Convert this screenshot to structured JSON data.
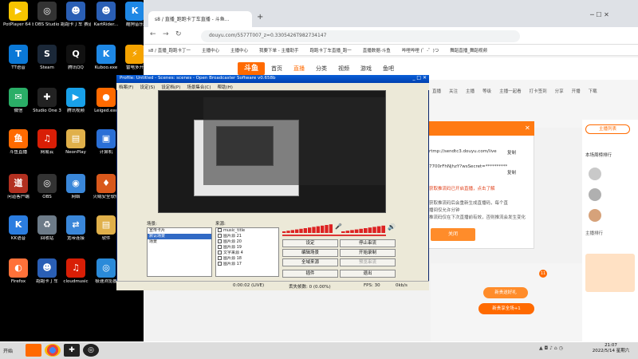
{
  "desktop": {
    "icons": [
      {
        "label": "PotPlayer 64 bit",
        "glyph": "▶",
        "color": "#f7c400"
      },
      {
        "label": "OBS Studio",
        "glyph": "◎",
        "color": "#333333"
      },
      {
        "label": "跑跑卡丁车 赛道",
        "glyph": "☻",
        "color": "#2a5fb5"
      },
      {
        "label": "KartRider...",
        "glyph": "☻",
        "color": "#2a5fb5"
      },
      {
        "label": "酷狗音乐",
        "glyph": "K",
        "color": "#1e88e5"
      },
      {
        "label": "TT语音",
        "glyph": "T",
        "color": "#0a78d7"
      },
      {
        "label": "Steam",
        "glyph": "S",
        "color": "#1b2838"
      },
      {
        "label": "腾讯QQ",
        "glyph": "Q",
        "color": "#111111"
      },
      {
        "label": "Kuboo.exe",
        "glyph": "K",
        "color": "#1e88e5"
      },
      {
        "label": "雷电多开",
        "glyph": "⚡",
        "color": "#f5a300"
      },
      {
        "label": "微信",
        "glyph": "✉",
        "color": "#2aae67"
      },
      {
        "label": "Studio One 3",
        "glyph": "✚",
        "color": "#222222"
      },
      {
        "label": "腾讯视频",
        "glyph": "▶",
        "color": "#18a0e8"
      },
      {
        "label": "Leiged.exe",
        "glyph": "●",
        "color": "#ff6a00"
      },
      {
        "label": "Administr...",
        "glyph": "▤",
        "color": "#e0b04a"
      },
      {
        "label": "斗鱼直播",
        "glyph": "鱼",
        "color": "#ff6a00"
      },
      {
        "label": "网易云",
        "glyph": "♫",
        "color": "#d81e06"
      },
      {
        "label": "NeonPlay",
        "glyph": "▤",
        "color": "#e0b04a"
      },
      {
        "label": "计算机",
        "glyph": "▣",
        "color": "#2a6fd6"
      },
      {
        "label": "斗鱼直播伴侣",
        "glyph": "鱼",
        "color": "#ff6a00"
      },
      {
        "label": "问道客户端",
        "glyph": "道",
        "color": "#b23020"
      },
      {
        "label": "OBS",
        "glyph": "◎",
        "color": "#333333"
      },
      {
        "label": "网络",
        "glyph": "◉",
        "color": "#3a87d9"
      },
      {
        "label": "火绒安全软件",
        "glyph": "♦",
        "color": "#d9581b"
      },
      {
        "label": "Media",
        "glyph": "▤",
        "color": "#e0b04a"
      },
      {
        "label": "KK语音",
        "glyph": "K",
        "color": "#2b7de0"
      },
      {
        "label": "回收站",
        "glyph": "♻",
        "color": "#6d7b88"
      },
      {
        "label": "宽带连接",
        "glyph": "⇄",
        "color": "#3a87d9"
      },
      {
        "label": "软件",
        "glyph": "▤",
        "color": "#e0b04a"
      },
      {
        "label": "TT开播",
        "glyph": "T",
        "color": "#0a78d7"
      },
      {
        "label": "Firefox",
        "glyph": "◐",
        "color": "#ff7139"
      },
      {
        "label": "跑跑卡丁车",
        "glyph": "☻",
        "color": "#2a5fb5"
      },
      {
        "label": "cloudmusic",
        "glyph": "♫",
        "color": "#d81e06"
      },
      {
        "label": "极速浏览器",
        "glyph": "◎",
        "color": "#2a8ad9"
      },
      {
        "label": "History",
        "glyph": "▤",
        "color": "#e0b04a"
      }
    ]
  },
  "browser": {
    "tab_title": "s8 / 直播_跑跑卡丁车直播 - 斗鱼...",
    "new_tab": "+",
    "url": "douyu.com/5577T007_z=0.3305426T982734147",
    "bookmarks": [
      "s8 / 直播_跑跑卡丁一",
      "主播中心",
      "主播中心",
      "我要下单 - 主播助手",
      "跑跑卡丁车直播_跑一",
      "直播数据-斗鱼",
      "哔哩哔哩 (゜-゜)つ",
      "舞蹈直播_舞蹈视频"
    ],
    "logo": "斗鱼",
    "nav": [
      "首页",
      "直播",
      "分类",
      "视频",
      "游戏",
      "鱼吧"
    ],
    "quick_links": [
      "直播",
      "关注",
      "主播",
      "等级",
      "主播一起看",
      "打卡签到",
      "分享",
      "开播",
      "下载"
    ],
    "dialog": {
      "title_text": "",
      "line1": "rtmp://sendtc3.douyu.com/live",
      "line1_btn": "复制",
      "line2": "7700rFhNjhzY?wsSecret=**********",
      "line2_btn": "复制",
      "link": "获取推流码已开启直播，点击了解",
      "note1": "获取推流码后会重新生成直播码，每个直",
      "note2": "播间仅允许分钟",
      "note3": "推流码仅在下次直播前有效，否则推流会发生变化",
      "close_btn": "关闭"
    },
    "right_panel": {
      "btn": "主播列表",
      "title": "本场周榜排行",
      "rank": "主播排行",
      "follow": "关注",
      "badge": "11",
      "gift": "新贵送好礼",
      "gift_sub": "新贵享全场+1"
    }
  },
  "obs": {
    "title": "Profile: Untitled - Scenes: scenes - Open Broadcaster Software v0.658b",
    "menu": [
      "档案(F)",
      "设定(S)",
      "设定档(P)",
      "场景集合(C)",
      "帮助(H)"
    ],
    "scenes_label": "场景:",
    "sources_label": "来源:",
    "scenes": [
      "宣传卡片",
      "默认场景",
      "场景"
    ],
    "selected_scene": 1,
    "sources": [
      "music_title",
      "图片源 21",
      "图片源 20",
      "图片源 19",
      "文字来源 4",
      "图片源 18",
      "图片源 17"
    ],
    "buttons": [
      "设定",
      "停止串流",
      "编辑场景",
      "开始录制",
      "全域来源",
      "预览串流",
      "插件",
      "退出"
    ],
    "status": {
      "time": "0:00:02 (LIVE)",
      "dropped": "丢失帧数: 0 (0.00%)",
      "fps": "FPS: 30",
      "bitrate": "0kb/s"
    }
  },
  "taskbar": {
    "start": "开始",
    "time": "21:07",
    "date": "2022/5/14 星期六"
  }
}
